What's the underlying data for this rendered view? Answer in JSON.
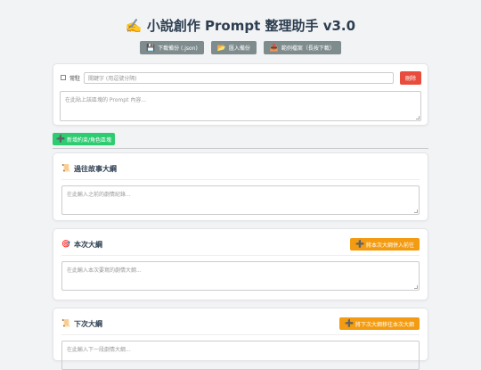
{
  "app": {
    "title": "✍️ 小說創作 Prompt 整理助手 v3.0"
  },
  "toolbar": {
    "backup_label": "下載備份 (.json)",
    "import_label": "匯入備份",
    "example_label": "範例檔案（長按下載）"
  },
  "prompt": {
    "checkbox_label": "常駐",
    "keyword_placeholder": "關鍵字 (用逗號分隔)",
    "delete_label": "刪除",
    "content_placeholder": "在此貼上該區塊的 Prompt 內容..."
  },
  "add_button_label": "新增約束/角色區塊",
  "sections": [
    {
      "title": "過往故事大綱",
      "icon": "📜",
      "placeholder": "在此輸入之前的劇情紀錄..."
    },
    {
      "title": "本次大綱",
      "icon": "🎯",
      "button_label": "將本次大綱併入前往",
      "placeholder": "在此輸入本次要寫的劇情大綱..."
    },
    {
      "title": "下次大綱",
      "icon": "📜",
      "button_label": "將下次大綱移往本次大綱",
      "placeholder": "在此輸入下一段劇情大綱..."
    }
  ],
  "icons": {
    "backup": "floppy-icon",
    "import": "folder-icon",
    "example": "inbox-icon",
    "add": "plus-icon"
  },
  "colors": {
    "toolbar_button": "#7f8c8d",
    "delete_button": "#e74c3c",
    "add_button": "#2ecc71",
    "orange_button": "#f39c12",
    "title": "#2c3e50"
  }
}
